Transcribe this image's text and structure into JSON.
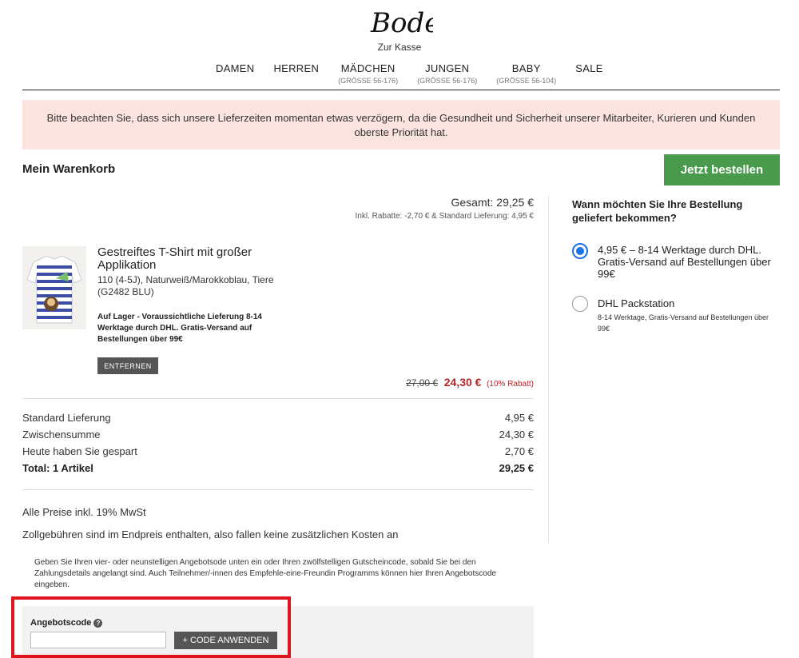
{
  "header": {
    "logo_text": "Boden",
    "subtitle": "Zur Kasse",
    "nav": [
      {
        "label": "DAMEN",
        "sub": ""
      },
      {
        "label": "HERREN",
        "sub": ""
      },
      {
        "label": "MÄDCHEN",
        "sub": "(GRÖSSE 56-176)"
      },
      {
        "label": "JUNGEN",
        "sub": "(GRÖSSE 56-176)"
      },
      {
        "label": "BABY",
        "sub": "(GRÖSSE 56-104)"
      },
      {
        "label": "SALE",
        "sub": ""
      }
    ]
  },
  "notice": "Bitte beachten Sie, dass sich unsere Lieferzeiten momentan etwas verzögern, da die Gesundheit und Sicherheit unserer Mitarbeiter, Kurieren und Kunden oberste Priorität hat.",
  "cart": {
    "title": "Mein Warenkorb",
    "order_button": "Jetzt bestellen",
    "total": "Gesamt: 29,25 €",
    "total_detail": "Inkl. Rabatte: -2,70 € & Standard Lieferung: 4,95 €",
    "item": {
      "name": "Gestreiftes T-Shirt mit großer Applikation",
      "variant": "110 (4-5J), Naturweiß/Marokkoblau, Tiere (G2482 BLU)",
      "stock": "Auf Lager - Voraussichtliche Lieferung 8-14 Werktage durch DHL. Gratis-Versand auf Bestellungen über 99€",
      "remove_label": "ENTFERNEN",
      "price_old": "27,00 €",
      "price_new": "24,30 €",
      "discount": "(10% Rabatt)"
    },
    "summary": [
      {
        "label": "Standard Lieferung",
        "value": "4,95 €"
      },
      {
        "label": "Zwischensumme",
        "value": "24,30 €"
      },
      {
        "label": "Heute haben Sie gespart",
        "value": "2,70 €"
      },
      {
        "label": "Total: 1 Artikel",
        "value": "29,25 €"
      }
    ],
    "vat_note": "Alle Preise inkl. 19% MwSt",
    "duty_note": "Zollgebühren sind im Endpreis enthalten, also fallen keine zusätzlichen Kosten an"
  },
  "delivery": {
    "question": "Wann möchten Sie Ihre Bestellung geliefert bekommen?",
    "option1": "4,95 € – 8-14 Werktage durch DHL. Gratis-Versand auf Bestellungen über 99€",
    "option2_title": "DHL Packstation",
    "option2_sub": "8-14 Werktage, Gratis-Versand auf Bestellungen über 99€",
    "selected": 1
  },
  "promo": {
    "info": "Geben Sie Ihren vier- oder neunstelligen Angebotsode unten ein oder Ihren zwölfstelligen Gutscheincode, sobald Sie bei den Zahlungsdetails angelangt sind. Auch Teilnehmer/-innen des Empfehle-eine-Freundin Programms können hier Ihren Angebotscode eingeben.",
    "label": "Angebotscode",
    "help_glyph": "?",
    "input_value": "",
    "apply_label": "+ CODE ANWENDEN"
  },
  "colors": {
    "accent_green": "#4a9a4d",
    "sale_red": "#b3262b",
    "notice_bg": "#fbe4df",
    "radio_blue": "#1a73e8",
    "highlight_red": "#e0141e"
  }
}
